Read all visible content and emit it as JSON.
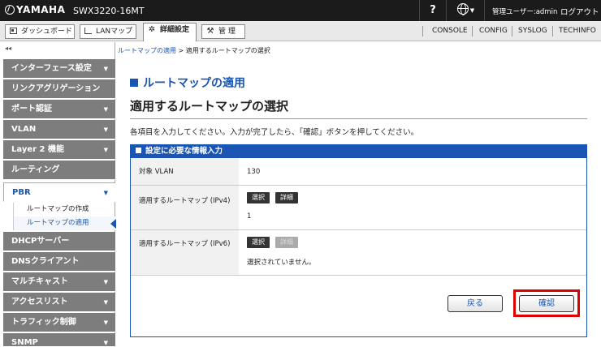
{
  "app": {
    "brand": "YAMAHA",
    "model": "SWX3220-16MT",
    "help": "?",
    "user": "管理ユーザー:admin",
    "logout": "ログアウト"
  },
  "nav": {
    "dashboard": "ダッシュボード",
    "lanmap": "LANマップ",
    "detail": "詳細設定",
    "manage": "管 理",
    "links": [
      "CONSOLE",
      "CONFIG",
      "SYSLOG",
      "TECHINFO"
    ]
  },
  "sidebar": {
    "collapse": "◂◂",
    "items": [
      {
        "label": "インターフェース設定",
        "arrow": "▼"
      },
      {
        "label": "リンクアグリゲーション",
        "arrow": ""
      },
      {
        "label": "ポート認証",
        "arrow": "▼"
      },
      {
        "label": "VLAN",
        "arrow": "▼"
      },
      {
        "label": "Layer 2 機能",
        "arrow": "▼"
      },
      {
        "label": "ルーティング",
        "arrow": ""
      },
      {
        "label": "PBR",
        "arrow": "▼"
      },
      {
        "label": "DHCPサーバー",
        "arrow": ""
      },
      {
        "label": "DNSクライアント",
        "arrow": ""
      },
      {
        "label": "マルチキャスト",
        "arrow": "▼"
      },
      {
        "label": "アクセスリスト",
        "arrow": "▼"
      },
      {
        "label": "トラフィック制御",
        "arrow": "▼"
      },
      {
        "label": "SNMP",
        "arrow": "▼"
      }
    ],
    "sub": [
      "ルートマップの作成",
      "ルートマップの適用"
    ]
  },
  "breadcrumb": {
    "link": "ルートマップの適用",
    "current": " > 適用するルートマップの選択"
  },
  "main": {
    "section_title": "ルートマップの適用",
    "page_title": "適用するルートマップの選択",
    "instruction": "各項目を入力してください。入力が完了したら、「確認」ボタンを押してください。",
    "panel_title": "設定に必要な情報入力",
    "rows": {
      "vlan_label": "対象 VLAN",
      "vlan_value": "130",
      "ipv4_label": "適用するルートマップ (IPv4)",
      "ipv4_value": "1",
      "ipv6_label": "適用するルートマップ (IPv6)",
      "ipv6_value": "選択されていません。"
    },
    "select": "選択",
    "detail": "詳細",
    "back": "戻る",
    "confirm": "確認"
  }
}
